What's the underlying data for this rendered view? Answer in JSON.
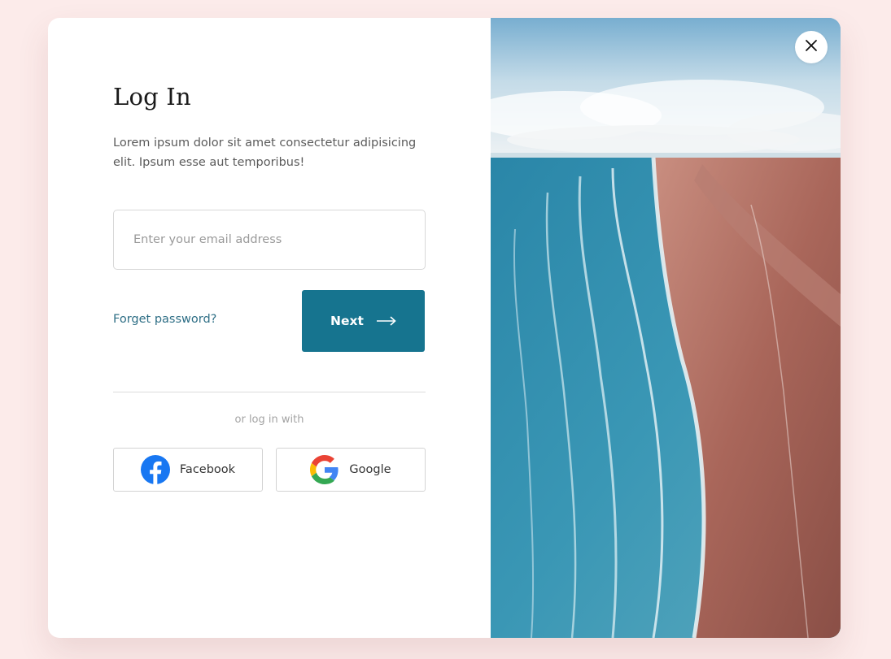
{
  "login": {
    "title": "Log In",
    "description": "Lorem ipsum dolor sit amet consectetur adipisicing elit. Ipsum esse aut temporibus!",
    "email_placeholder": "Enter your email address",
    "forgot_label": "Forget password?",
    "next_label": "Next",
    "alt_label": "or log in with",
    "social": [
      {
        "label": "Facebook",
        "icon": "facebook-icon"
      },
      {
        "label": "Google",
        "icon": "google-icon"
      }
    ]
  },
  "image": {
    "icon": "beach-photo"
  },
  "close": {
    "icon": "close-icon"
  },
  "colors": {
    "background": "#fcebea",
    "primary": "#16748f",
    "link": "#2f6f86",
    "facebook": "#1877f2"
  }
}
